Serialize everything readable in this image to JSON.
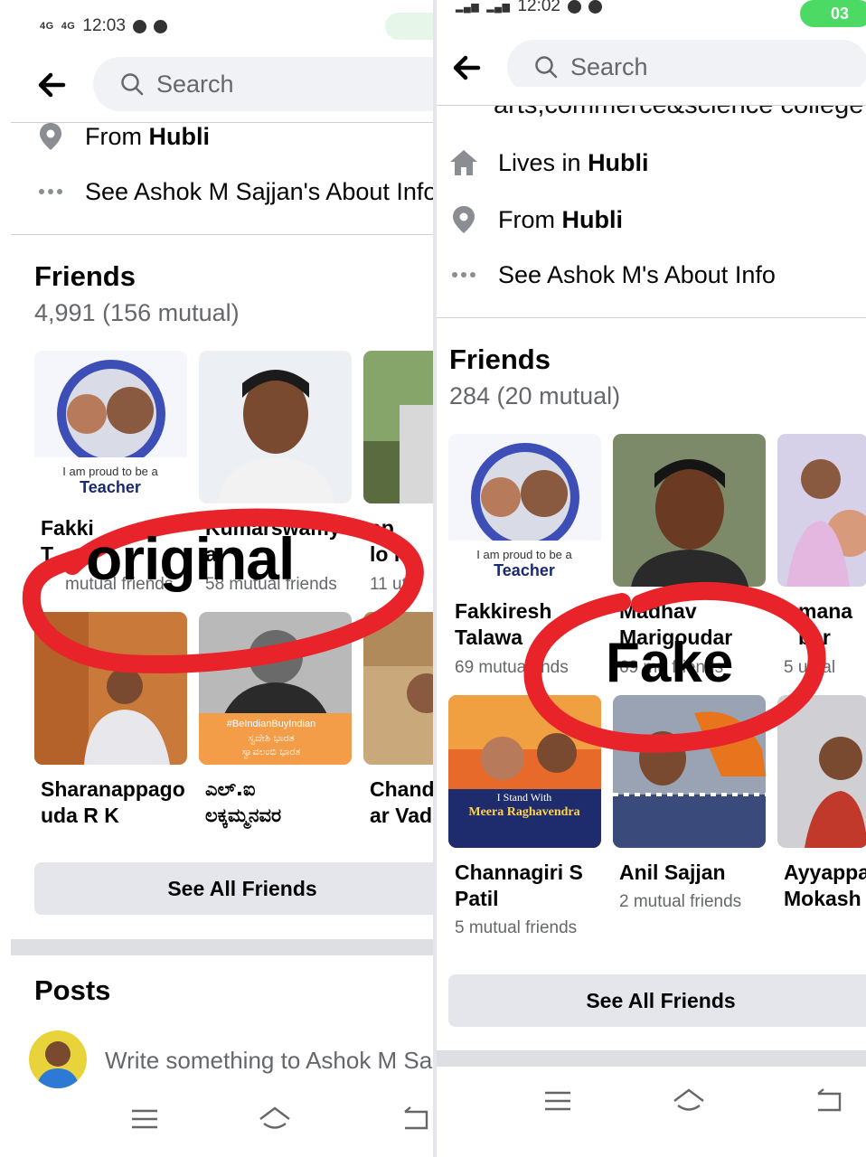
{
  "left": {
    "status": {
      "network1": "4G",
      "network2": "4G",
      "time": "12:03"
    },
    "search_placeholder": "Search",
    "from_label": "From ",
    "from_city": "Hubli",
    "about_link": "See Ashok M Sajjan's About Info",
    "friends_title": "Friends",
    "friends_count": "4,991 (156 mutual)",
    "friends": [
      {
        "name": "Fakki\nT",
        "mutual": "mutual friends",
        "photo_caption_1": "I am proud to be a",
        "photo_caption_2": "Teacher"
      },
      {
        "name": "Kumarswamy\n            a",
        "mutual": "58 mutual friends"
      },
      {
        "name": "ap\nlo m",
        "mutual": "11 ut"
      },
      {
        "name": "Sharanappago\nuda R K",
        "mutual": "",
        "badge_1": "#BeIndianBuyIndian",
        "badge_2": "ಸ್ವದೇಶಿ ಭಾರತ",
        "badge_3": "ಸ್ವಾವಲಂಬಿ ಭಾರತ"
      },
      {
        "name": "ಎಲ್.ಐ\nಲಕ್ಕಮ್ಮನವರ",
        "mutual": ""
      },
      {
        "name": "Chand\nar Vad",
        "mutual": ""
      }
    ],
    "see_all": "See All Friends",
    "posts_title": "Posts",
    "composer_placeholder": "Write something to Ashok M Sa",
    "overlay_word": "original"
  },
  "right": {
    "status": {
      "time": "12:02",
      "call": "03"
    },
    "search_placeholder": "Search",
    "cut_line": "arts,commerce&science college",
    "lives_label": "Lives in ",
    "lives_city": "Hubli",
    "from_label": "From ",
    "from_city": "Hubli",
    "about_link": "See Ashok M's About Info",
    "friends_title": "Friends",
    "friends_count": "284 (20 mutual)",
    "friends": [
      {
        "name": "Fakkiresh\nTalawa",
        "mutual": "69 mutua     ends",
        "photo_caption_1": "I am proud to be a",
        "photo_caption_2": "Teacher"
      },
      {
        "name": "Madhav\nMarigoudar",
        "mutual": "69 mu      friends"
      },
      {
        "name": "mana\nber",
        "mutual": "5    utual"
      },
      {
        "name": "Channagiri S\nPatil",
        "mutual": "5 mutual friends",
        "photo_caption_1": "I Stand With",
        "photo_caption_2": "Meera Raghavendra"
      },
      {
        "name": "Anil Sajjan",
        "mutual": "2 mutual friends"
      },
      {
        "name": "Ayyappa\nMokash",
        "mutual": ""
      }
    ],
    "see_all": "See All Friends",
    "overlay_word": "Fake"
  },
  "colors": {
    "accent_red": "#e8232a",
    "search_bg": "#f0f2f5",
    "button_bg": "#e4e6eb",
    "secondary_text": "#65676b"
  }
}
